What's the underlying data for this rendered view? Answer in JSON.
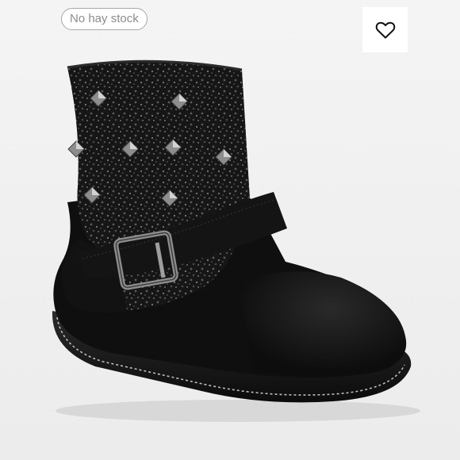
{
  "listing": {
    "stock_badge": "No hay stock"
  },
  "icons": {
    "favorite": "heart-outline-icon"
  },
  "colors": {
    "background": "#f1f1f1",
    "badge_border": "#a8a8a8",
    "badge_text": "#8c8c8c",
    "boot": "#111111"
  }
}
